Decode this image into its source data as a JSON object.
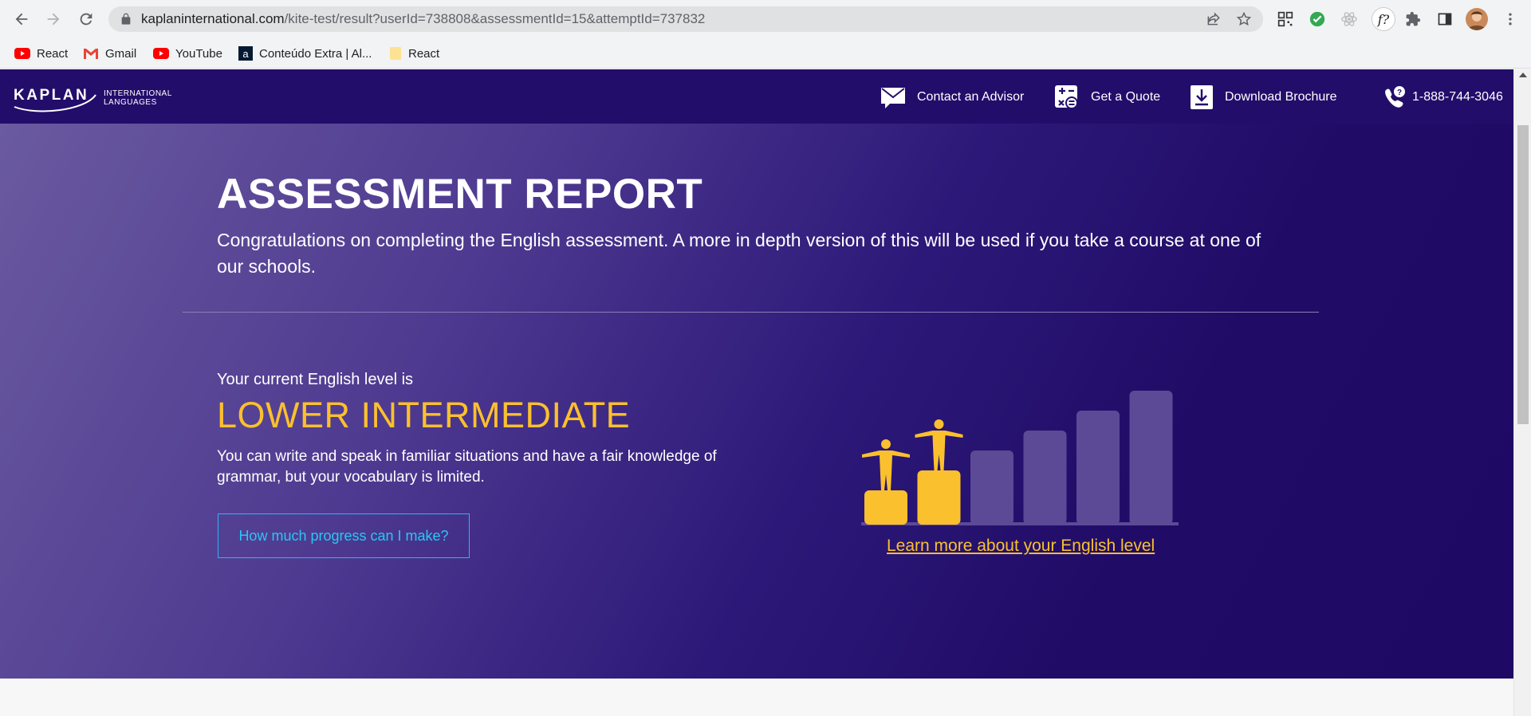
{
  "browser": {
    "url_domain": "kaplaninternational.com",
    "url_path": "/kite-test/result?userId=738808&assessmentId=15&attemptId=737832",
    "bookmarks": [
      {
        "label": "React",
        "icon": "youtube-icon"
      },
      {
        "label": "Gmail",
        "icon": "gmail-icon"
      },
      {
        "label": "YouTube",
        "icon": "youtube-icon"
      },
      {
        "label": "Conteúdo Extra | Al...",
        "icon": "alura-icon"
      },
      {
        "label": "React",
        "icon": "folder-icon"
      }
    ],
    "extension_label": "f?"
  },
  "header": {
    "logo_word": "KAPLAN",
    "logo_line1": "INTERNATIONAL",
    "logo_line2": "LANGUAGES",
    "links": {
      "contact": "Contact an Advisor",
      "quote": "Get a Quote",
      "brochure": "Download Brochure",
      "phone": "1-888-744-3046"
    }
  },
  "hero": {
    "title": "ASSESSMENT REPORT",
    "intro": "Congratulations on completing the English assessment. A more in depth version of this will be used if you take a course at one of our schools.",
    "level_prefix": "Your current English level is",
    "level_name": "LOWER INTERMEDIATE",
    "level_description": "You can write and speak in familiar situations and have a fair knowledge of grammar, but your vocabulary is limited.",
    "progress_button": "How much progress can I make?",
    "learn_more_link": "Learn more about your English level"
  },
  "level_chart": {
    "levels_total": 6,
    "levels_achieved": 2,
    "colors": {
      "achieved": "#fbc02d",
      "remaining": "#5c4a96"
    }
  },
  "colors": {
    "header_bg": "#230d6b",
    "accent_yellow": "#fbc02d",
    "button_border": "#29b6f6"
  }
}
